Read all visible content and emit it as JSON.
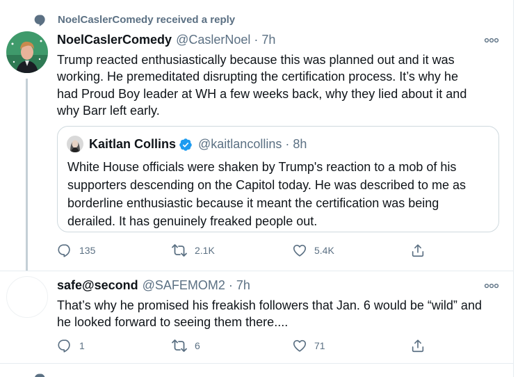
{
  "context": {
    "icon": "speech-bubble-icon",
    "text": "NoelCaslerComedy received a reply"
  },
  "tweet1": {
    "name": "NoelCaslerComedy",
    "handle": "@CaslerNoel",
    "separator": "·",
    "time": "7h",
    "text_lines": [
      "Trump reacted enthusiastically because this was planned out and it was",
      "working. He premeditated disrupting the certification process. It’s why he",
      "had Proud Boy leader at WH a few weeks back, why they lied about it and",
      "why Barr left early."
    ],
    "quote": {
      "name": "Kaitlan Collins",
      "verified": true,
      "handle": "@kaitlancollins",
      "separator": "·",
      "time": "8h",
      "text_lines": [
        "White House officials were shaken by Trump's reaction to a mob of his",
        "supporters descending on the Capitol today. He was described to me as",
        "borderline enthusiastic because it meant the certification was being",
        "derailed. It has genuinely freaked people out."
      ]
    },
    "actions": {
      "replies": "135",
      "retweets": "2.1K",
      "likes": "5.4K"
    }
  },
  "tweet2": {
    "name": "safe@second",
    "handle": "@SAFEMOM2",
    "separator": "·",
    "time": "7h",
    "text_lines": [
      "That’s why he promised his freakish followers that Jan. 6 would be “wild” and",
      "he looked forward to seeing them there...."
    ],
    "actions": {
      "replies": "1",
      "retweets": "6",
      "likes": "71"
    }
  },
  "colors": {
    "text": "#0f1419",
    "secondary": "#5b7083",
    "verified": "#1d9bf0",
    "border": "#cfd9de",
    "thread": "#c4cfd6"
  }
}
